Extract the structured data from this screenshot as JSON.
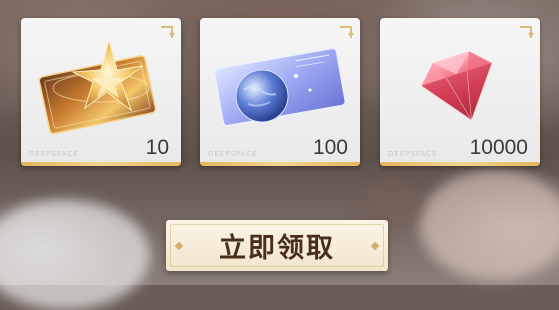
{
  "rewards": [
    {
      "name": "gold-star-ticket",
      "brand": "DEEPSPACE",
      "quantity": "10"
    },
    {
      "name": "planet-ticket",
      "brand": "DEEPSPACE",
      "quantity": "100"
    },
    {
      "name": "red-diamond",
      "brand": "DEEPSPACE",
      "quantity": "10000"
    }
  ],
  "claim_button": {
    "label": "立即领取"
  },
  "colors": {
    "card_bg": "#f2f2f3",
    "gold_accent": "#e5b55d",
    "button_bg": "#f6ecd7",
    "button_text": "#4a2e1d"
  }
}
